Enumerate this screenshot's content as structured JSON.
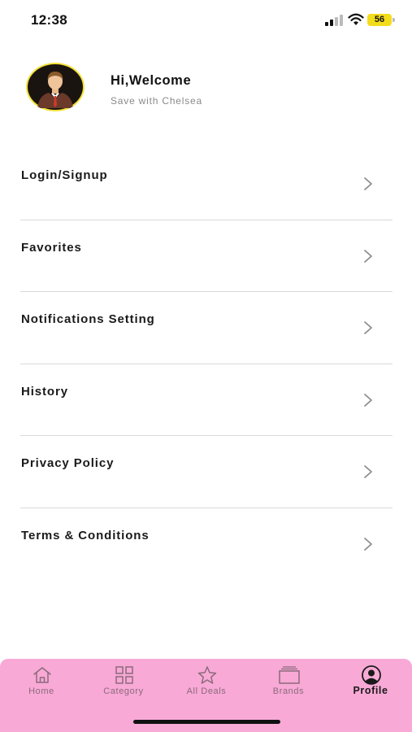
{
  "status_bar": {
    "time": "12:38",
    "battery_level": "56",
    "battery_color": "#f3dc1c"
  },
  "header": {
    "greeting": "Hi,Welcome",
    "subtitle": "Save with Chelsea"
  },
  "menu": {
    "items": [
      {
        "label": "Login/Signup"
      },
      {
        "label": "Favorites"
      },
      {
        "label": "Notifications Setting"
      },
      {
        "label": "History"
      },
      {
        "label": "Privacy Policy"
      },
      {
        "label": "Terms & Conditions"
      }
    ]
  },
  "tab_bar": {
    "background": "#f8a9d6",
    "tabs": [
      {
        "label": "Home",
        "icon": "home-icon"
      },
      {
        "label": "Category",
        "icon": "grid-icon"
      },
      {
        "label": "All Deals",
        "icon": "star-icon"
      },
      {
        "label": "Brands",
        "icon": "stack-icon"
      },
      {
        "label": "Profile",
        "icon": "profile-icon",
        "active": true
      }
    ]
  }
}
